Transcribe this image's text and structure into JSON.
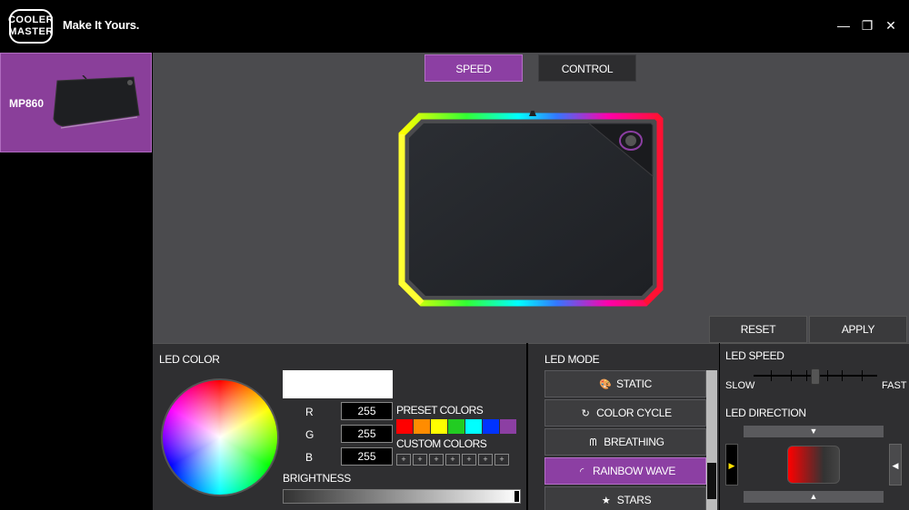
{
  "header": {
    "logo_line1": "COOLER",
    "logo_line2": "MASTER",
    "tagline": "Make It Yours."
  },
  "window_controls": {
    "minimize": "—",
    "maximize": "❐",
    "close": "✕"
  },
  "device": {
    "name": "MP860"
  },
  "tabs": [
    {
      "label": "SPEED",
      "active": true
    },
    {
      "label": "CONTROL",
      "active": false
    }
  ],
  "actions": {
    "reset": "RESET",
    "apply": "APPLY"
  },
  "led_color": {
    "title": "LED COLOR",
    "r_label": "R",
    "g_label": "G",
    "b_label": "B",
    "r": "255",
    "g": "255",
    "b": "255",
    "preset_title": "PRESET COLORS",
    "presets": [
      "#ff0000",
      "#ff8c00",
      "#ffff00",
      "#22cc22",
      "#00ffff",
      "#0033ff",
      "#8c3fa3"
    ],
    "custom_title": "CUSTOM COLORS",
    "custom_slots": [
      "+",
      "+",
      "+",
      "+",
      "+",
      "+",
      "+"
    ],
    "brightness_label": "BRIGHTNESS",
    "brightness": 1.0
  },
  "led_mode": {
    "title": "LED MODE",
    "modes": [
      {
        "label": "STATIC",
        "icon": "palette-icon",
        "glyph": "🎨",
        "active": false
      },
      {
        "label": "COLOR CYCLE",
        "icon": "refresh-icon",
        "glyph": "↻",
        "active": false
      },
      {
        "label": "BREATHING",
        "icon": "lungs-icon",
        "glyph": "ᗰ",
        "active": false
      },
      {
        "label": "RAINBOW WAVE",
        "icon": "rainbow-icon",
        "glyph": "◜",
        "active": true
      },
      {
        "label": "STARS",
        "icon": "star-icon",
        "glyph": "★",
        "active": false
      }
    ]
  },
  "led_speed": {
    "title": "LED SPEED",
    "slow": "SLOW",
    "fast": "FAST",
    "level": 0.5
  },
  "led_direction": {
    "title": "LED DIRECTION"
  },
  "colors": {
    "accent": "#8c3fa3",
    "panel": "#2f2f31",
    "canvas": "#4b4b4e"
  }
}
